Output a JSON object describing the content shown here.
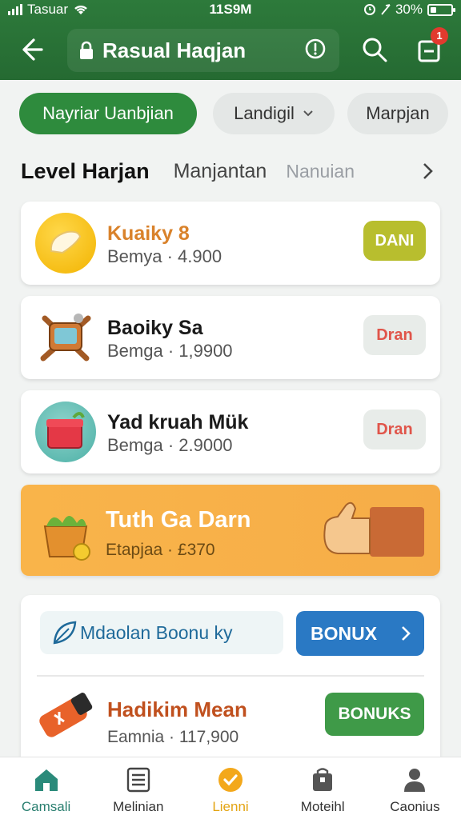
{
  "status_bar": {
    "carrier": "Tasuar",
    "time": "11S9M",
    "battery": "30%",
    "battery_level": 0.3
  },
  "app_bar": {
    "title": "Rasual Haqjan",
    "cart_badge": "1"
  },
  "filters": [
    {
      "label": "Nayriar Uanbjian",
      "active": true
    },
    {
      "label": "Landigil",
      "active": false
    },
    {
      "label": "Marpjan",
      "active": false
    }
  ],
  "tabs": {
    "main": "Level Harjan",
    "second": "Manjantan",
    "third": "Nanuian"
  },
  "items": [
    {
      "name": "Kuaiky 8",
      "price": "Bemya · 4.900",
      "button": "DANI",
      "name_color": "#d9822b",
      "btn_bg": "#b8be2e",
      "btn_fg": "#ffffff",
      "icon": "glove-icon"
    },
    {
      "name": "Baoiky Sa",
      "price": "Bemga · 1,9900",
      "button": "Dran",
      "name_color": "#1a1a1a",
      "btn_bg": "#e8ece9",
      "btn_fg": "#e0554a",
      "icon": "robot-toy-icon"
    },
    {
      "name": "Yad kruah Mük",
      "price": "Bemga · 2.9000",
      "button": "Dran",
      "name_color": "#1a1a1a",
      "btn_bg": "#e8ece9",
      "btn_fg": "#e0554a",
      "icon": "gift-box-icon"
    }
  ],
  "promo": {
    "title": "Tuth Ga Darn",
    "subtitle": "Etapjaa · £370"
  },
  "bonus": {
    "pill_text": "Mdaolan Boonu ky",
    "pill_button": "BONUX",
    "item_name": "Hadikim Mean",
    "item_price": "Eamnia · 117,900",
    "item_button": "BONUKS"
  },
  "bottom_nav": [
    {
      "label": "Camsali",
      "icon": "home-icon"
    },
    {
      "label": "Melinian",
      "icon": "list-icon"
    },
    {
      "label": "Lienni",
      "icon": "check-circle-icon"
    },
    {
      "label": "Moteihl",
      "icon": "bag-icon"
    },
    {
      "label": "Caonius",
      "icon": "person-icon"
    }
  ]
}
